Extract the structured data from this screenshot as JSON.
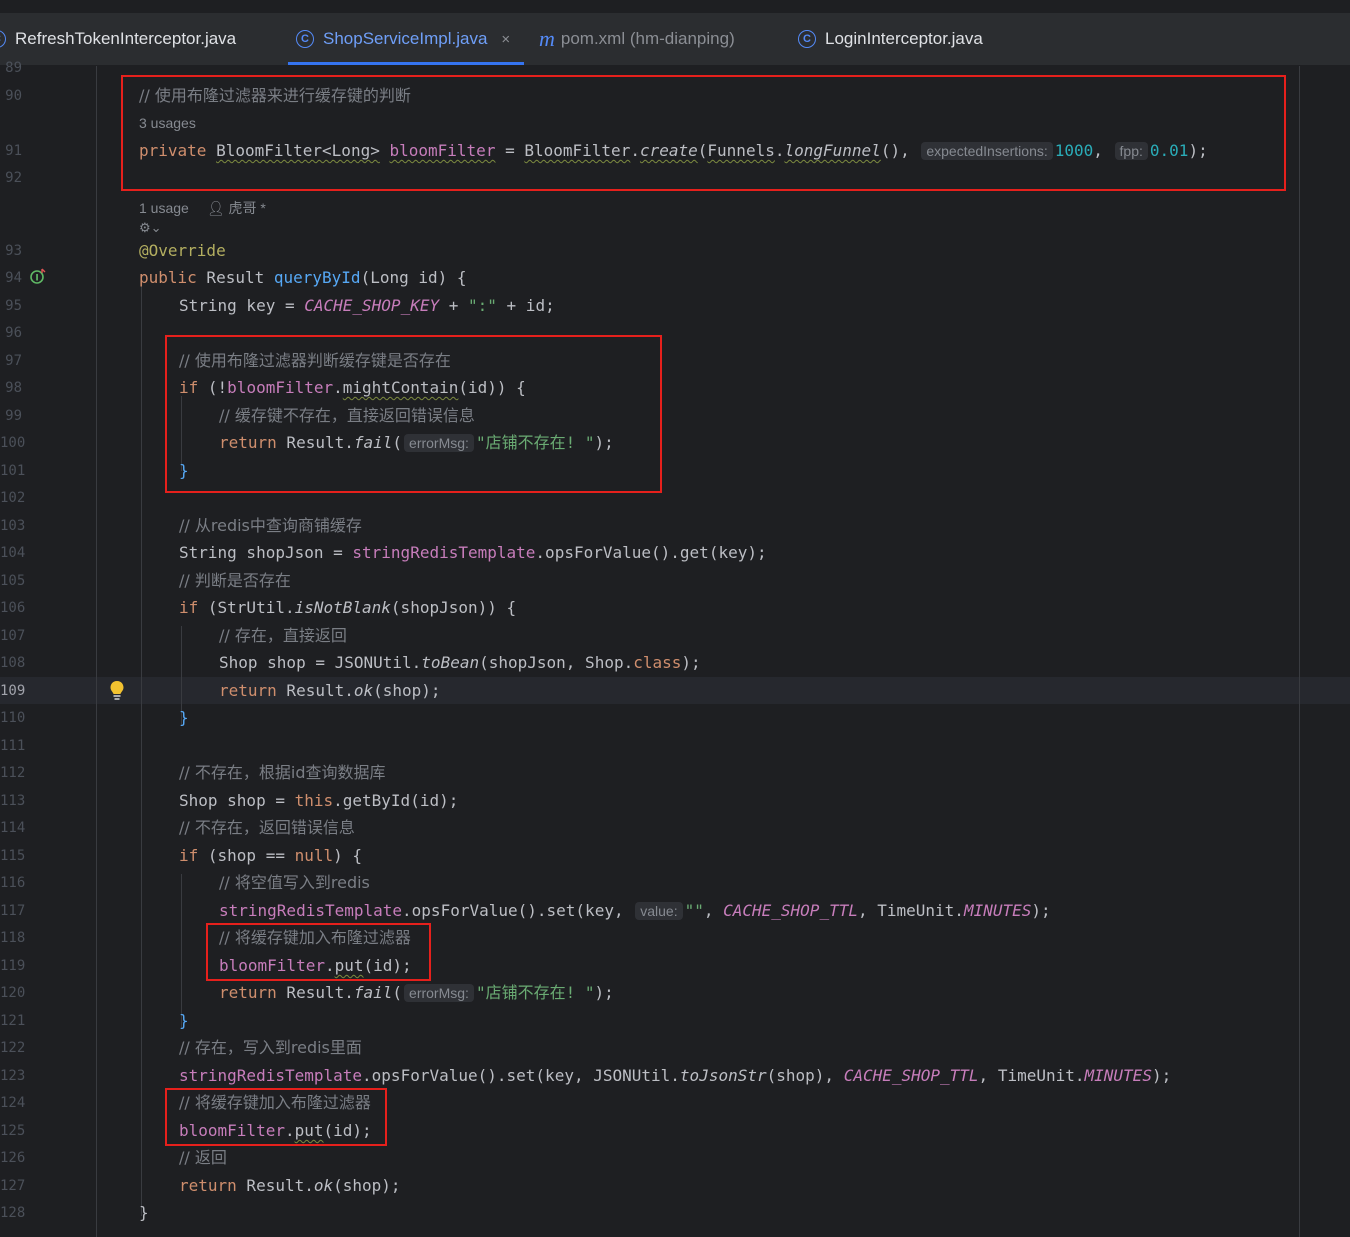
{
  "tabs": [
    {
      "label": "RefreshTokenInterceptor.java",
      "icon": "class-icon"
    },
    {
      "label": "ShopServiceImpl.java",
      "icon": "class-icon",
      "active": true,
      "close": "×"
    },
    {
      "label": "pom.xml (hm-dianping)",
      "icon": "maven-icon"
    },
    {
      "label": "LoginInterceptor.java",
      "icon": "class-icon"
    }
  ],
  "line_numbers": [
    "89",
    "90",
    "91",
    "92",
    "93",
    "94",
    "95",
    "96",
    "97",
    "98",
    "99",
    "100",
    "101",
    "102",
    "103",
    "104",
    "105",
    "106",
    "107",
    "108",
    "109",
    "110",
    "111",
    "112",
    "113",
    "114",
    "115",
    "116",
    "117",
    "118",
    "119",
    "120",
    "121",
    "122",
    "123",
    "124",
    "125",
    "126",
    "127",
    "128"
  ],
  "current_line": "109",
  "meta": {
    "usages_3": "3 usages",
    "usages_1": "1 usage",
    "author": "虎哥 *"
  },
  "code": {
    "l90_comment": "// 使用布隆过滤器来进行缓存键的判断",
    "l91_private": "private",
    "l91_type": "BloomFilter<Long>",
    "l91_var": "bloomFilter",
    "l91_eq": " = ",
    "l91_cls": "BloomFilter",
    "l91_create": "create",
    "l91_funnels": "Funnels",
    "l91_longFunnel": "longFunnel",
    "l91_hint1": "expectedInsertions:",
    "l91_num1": "1000",
    "l91_hint2": "fpp:",
    "l91_num2": "0.01",
    "l93": "@Override",
    "l94_public": "public",
    "l94_rest": " Result ",
    "l94_fn": "queryById",
    "l94_args": "(Long id) {",
    "l95_a": "String key = ",
    "l95_const": "CACHE_SHOP_KEY",
    "l95_b": " + ",
    "l95_str": "\":\"",
    "l95_c": " + id;",
    "l97": "// 使用布隆过滤器判断缓存键是否存在",
    "l98_if": "if",
    "l98_a": " (!",
    "l98_field": "bloomFilter",
    "l98_b": ".",
    "l98_fn": "mightContain",
    "l98_c": "(id)) {",
    "l99": "// 缓存键不存在，直接返回错误信息",
    "l100_return": "return",
    "l100_a": " Result.",
    "l100_fn": "fail",
    "l100_hint": "errorMsg:",
    "l100_str": "\"店铺不存在! \"",
    "l100_end": ");",
    "l101": "}",
    "l103": "// 从redis中查询商铺缓存",
    "l104_a": "String shopJson = ",
    "l104_field": "stringRedisTemplate",
    "l104_b": ".opsForValue().get(key);",
    "l105": "// 判断是否存在",
    "l106_if": "if",
    "l106_a": " (StrUtil.",
    "l106_fn": "isNotBlank",
    "l106_b": "(shopJson)) {",
    "l107": "// 存在，直接返回",
    "l108_a": "Shop shop = JSONUtil.",
    "l108_fn": "toBean",
    "l108_b": "(shopJson, Shop.",
    "l108_class": "class",
    "l108_c": ");",
    "l109_return": "return",
    "l109_a": " Result.",
    "l109_fn": "ok",
    "l109_b": "(shop);",
    "l110": "}",
    "l112": "// 不存在，根据id查询数据库",
    "l113_a": "Shop shop = ",
    "l113_this": "this",
    "l113_b": ".getById(id);",
    "l114": "// 不存在，返回错误信息",
    "l115_if": "if",
    "l115_a": " (shop == ",
    "l115_null": "null",
    "l115_b": ") {",
    "l116": "// 将空值写入到redis",
    "l117_field": "stringRedisTemplate",
    "l117_a": ".opsForValue().set(key, ",
    "l117_hint": "value:",
    "l117_str": "\"\"",
    "l117_b": ", ",
    "l117_const": "CACHE_SHOP_TTL",
    "l117_c": ", TimeUnit.",
    "l117_const2": "MINUTES",
    "l117_d": ");",
    "l118": "// 将缓存键加入布隆过滤器",
    "l119_field": "bloomFilter",
    "l119_a": ".",
    "l119_fn": "put",
    "l119_b": "(id);",
    "l120_return": "return",
    "l120_a": " Result.",
    "l120_fn": "fail",
    "l120_hint": "errorMsg:",
    "l120_str": "\"店铺不存在! \"",
    "l120_end": ");",
    "l121": "}",
    "l122": "// 存在，写入到redis里面",
    "l123_field": "stringRedisTemplate",
    "l123_a": ".opsForValue().set(key, JSONUtil.",
    "l123_fn": "toJsonStr",
    "l123_b": "(shop), ",
    "l123_const": "CACHE_SHOP_TTL",
    "l123_c": ", TimeUnit.",
    "l123_const2": "MINUTES",
    "l123_d": ");",
    "l124": "// 将缓存键加入布隆过滤器",
    "l125_field": "bloomFilter",
    "l125_a": ".",
    "l125_fn": "put",
    "l125_b": "(id);",
    "l126": "// 返回",
    "l127_return": "return",
    "l127_a": " Result.",
    "l127_fn": "ok",
    "l127_b": "(shop);",
    "l128": "}"
  },
  "colors": {
    "highlight_box": "#e6201c",
    "keyword": "#cf8e6d",
    "method": "#56a8f5",
    "field": "#c77dbb",
    "string": "#6aab73",
    "number": "#2aacb8",
    "comment": "#7a7e85"
  }
}
